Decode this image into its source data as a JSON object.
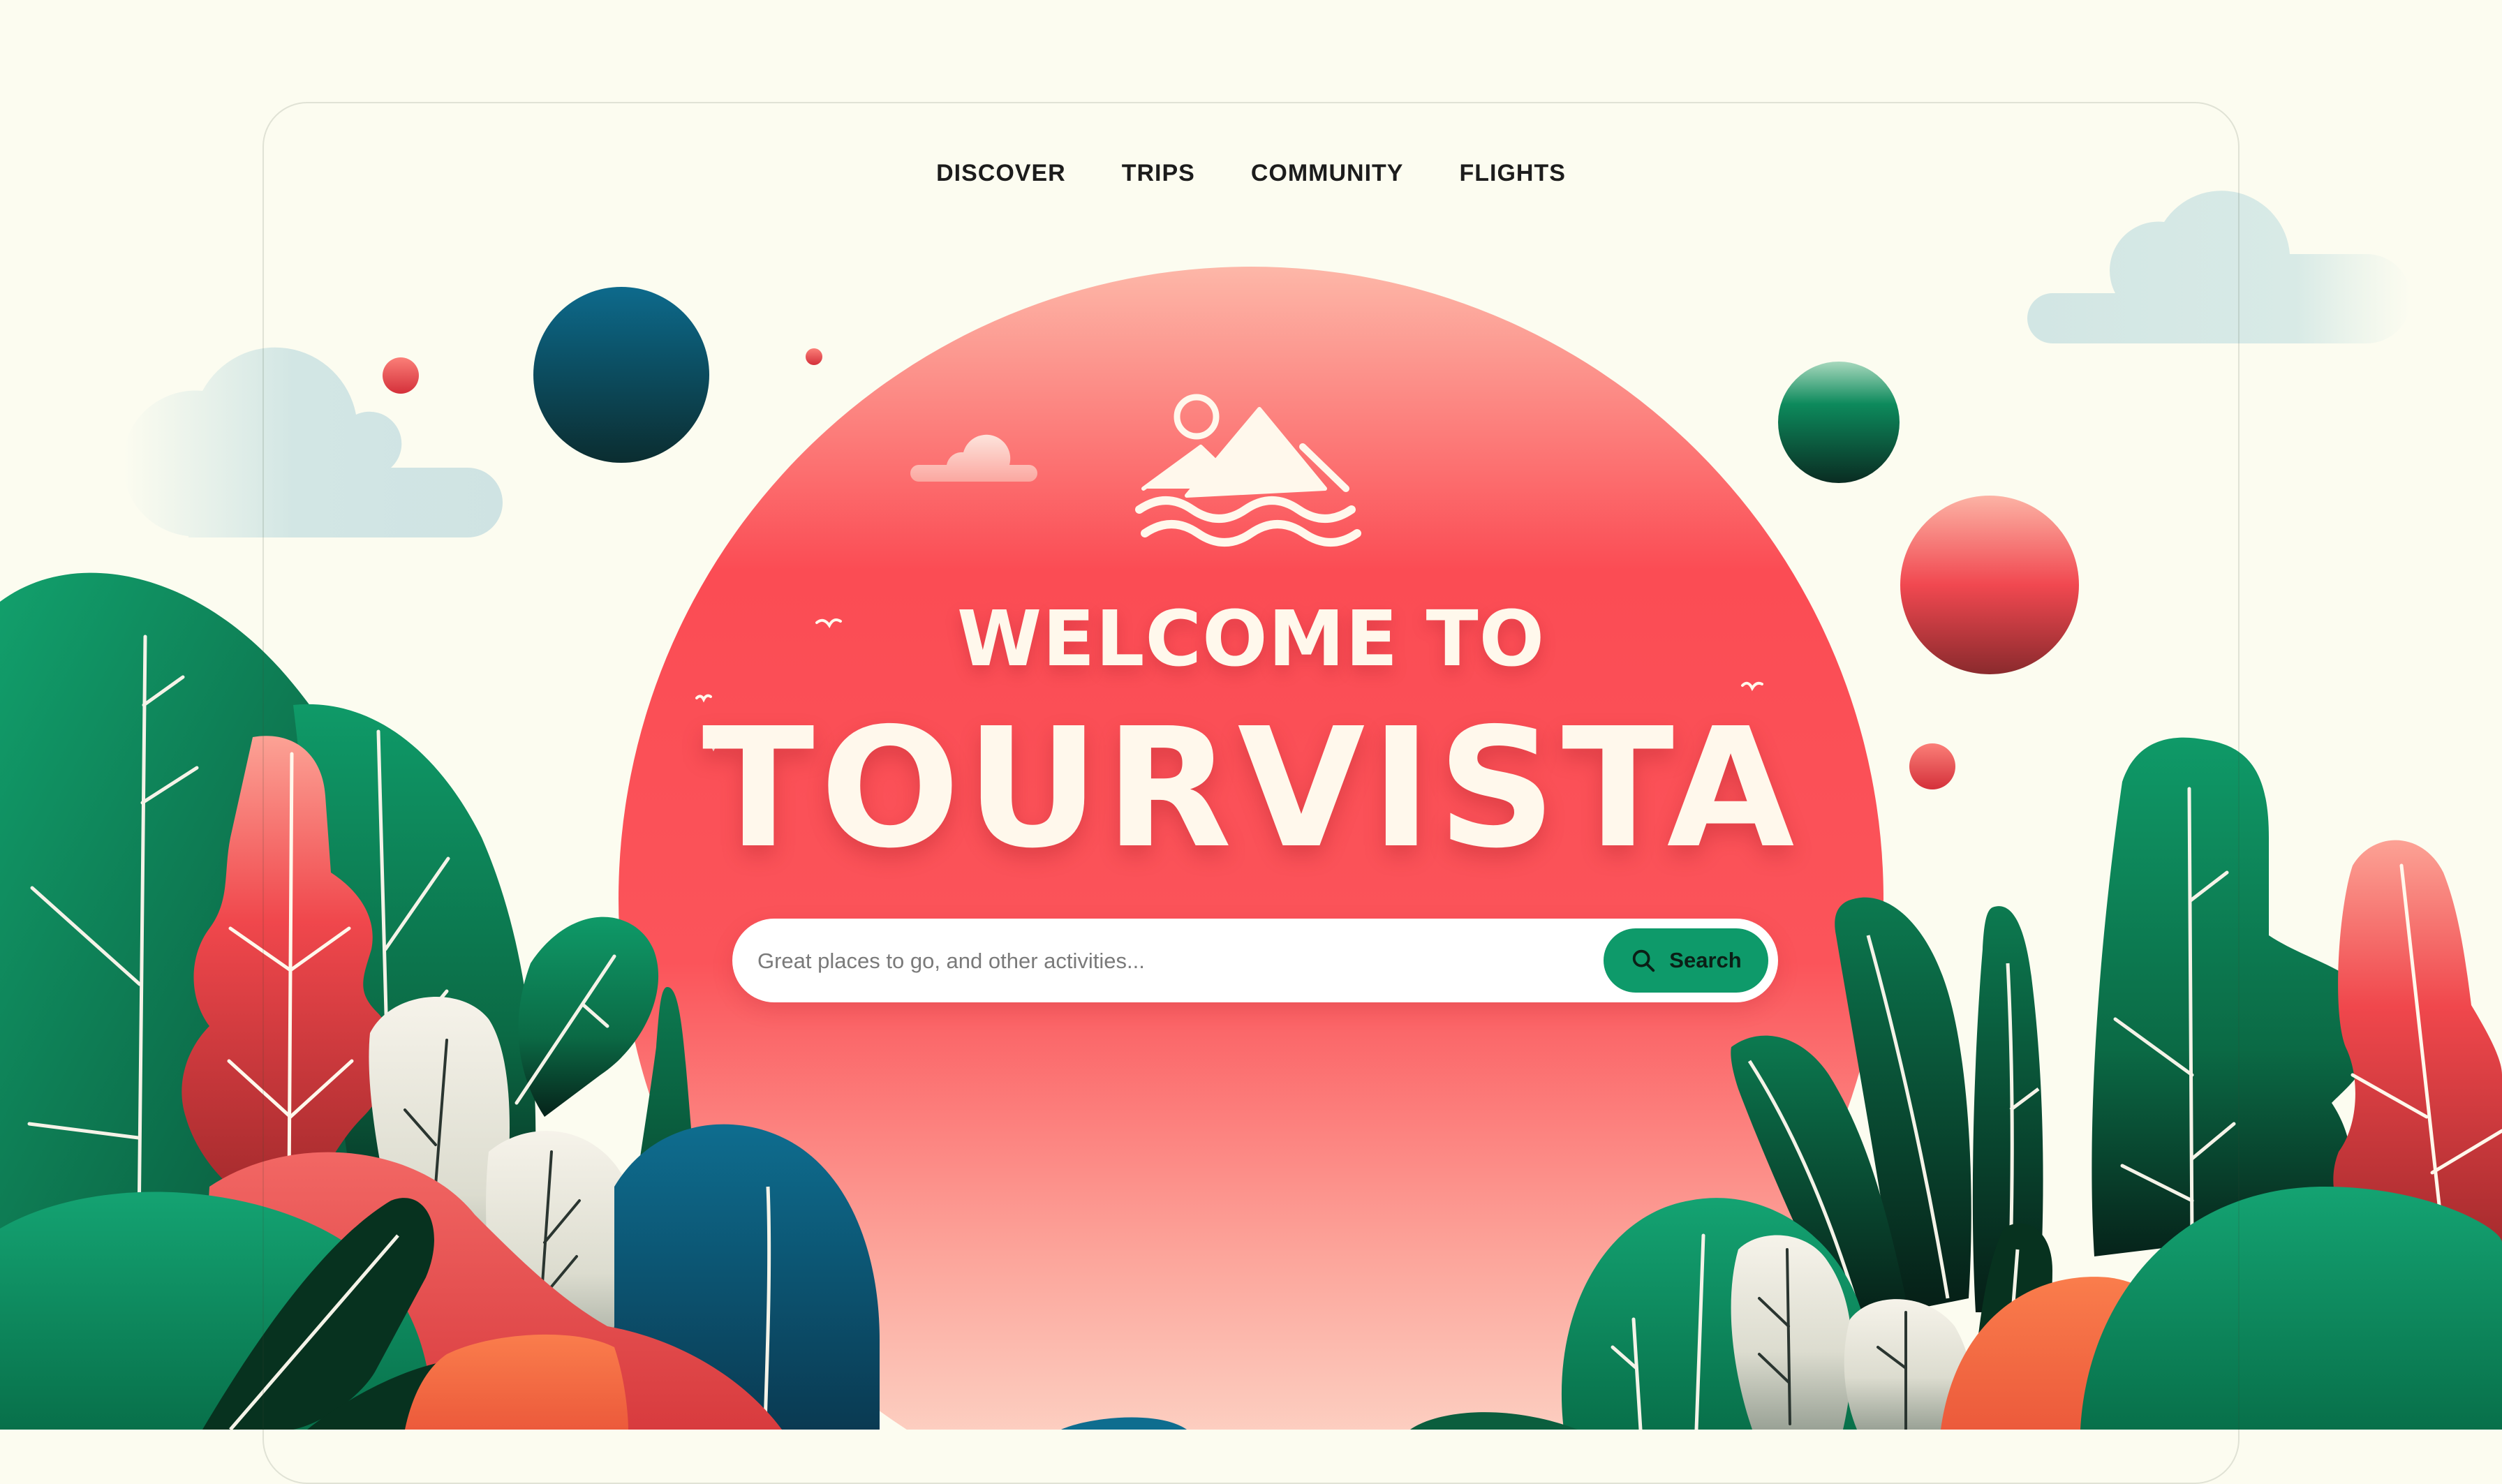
{
  "nav": {
    "items": [
      {
        "label": "DISCOVER"
      },
      {
        "label": "TRIPS"
      },
      {
        "label": "COMMUNITY"
      },
      {
        "label": "FLIGHTS"
      }
    ]
  },
  "hero": {
    "welcome": "WELCOME TO",
    "brand": "TOURVISTA",
    "logo_icon": "mountain-sun-waves-icon"
  },
  "search": {
    "placeholder": "Great places to go, and other activities...",
    "value": "",
    "button_label": "Search",
    "button_icon": "search-icon"
  },
  "colors": {
    "background": "#fcfcf0",
    "sun_red": "#fb4c54",
    "accent_green": "#0e9a6a",
    "dark_green": "#0b5e3e",
    "deep_blue": "#0f5478",
    "cream_text": "#fff8ec"
  }
}
